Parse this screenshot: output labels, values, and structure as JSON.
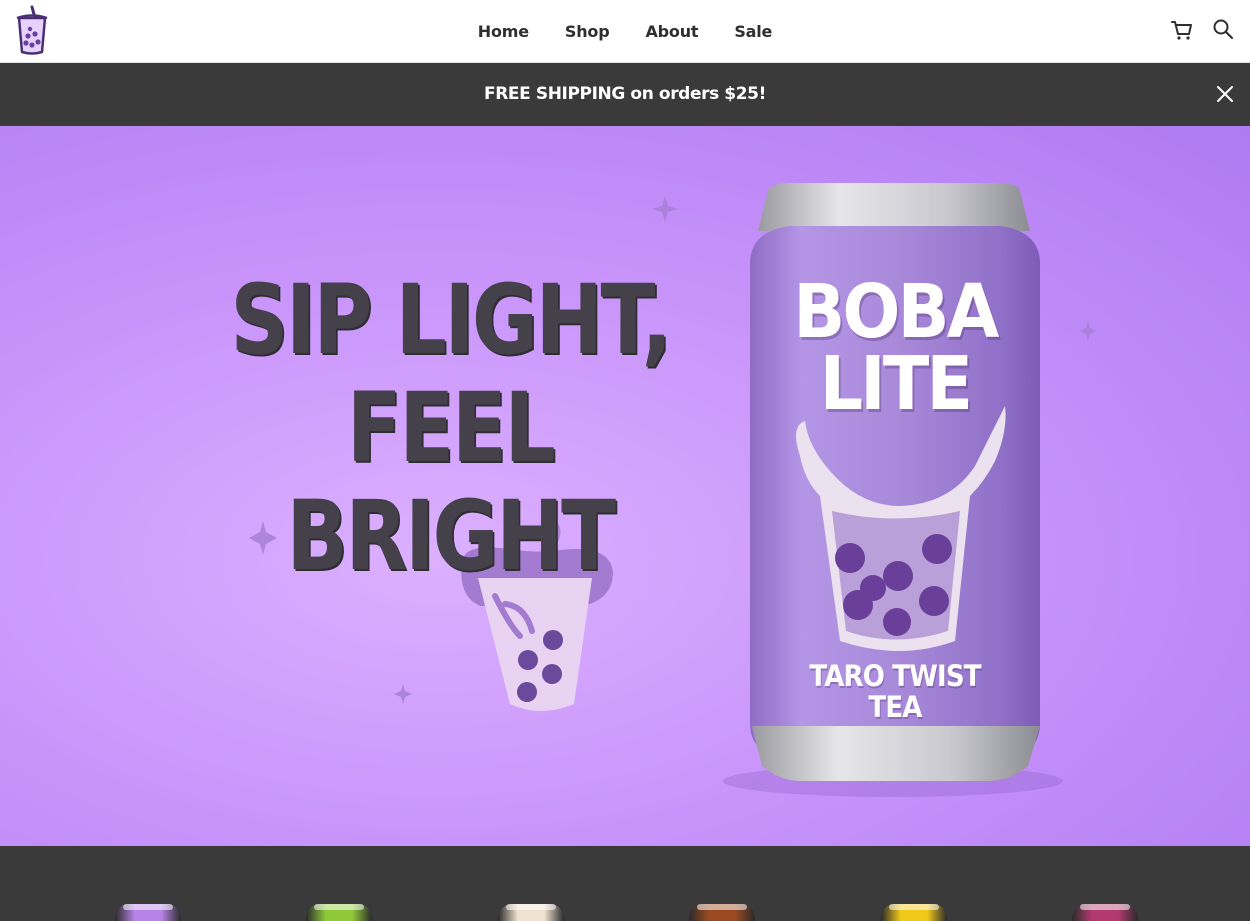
{
  "header": {
    "nav": [
      "Home",
      "Shop",
      "About",
      "Sale"
    ]
  },
  "icons": {
    "logo": "boba-cup-logo",
    "cart": "cart-icon",
    "search": "search-icon",
    "close": "close-icon"
  },
  "announcement": {
    "text": "FREE SHIPPING on orders $25!"
  },
  "hero": {
    "headline_line1": "SIP LIGHT,",
    "headline_line2": "FEEL BRIGHT",
    "can": {
      "brand_line1": "BOBA",
      "brand_line2": "LITE",
      "flavor_line1": "TARO TWIST",
      "flavor_line2": "TEA"
    }
  },
  "colors": {
    "hero_bg": "#c995fb",
    "headline": "#45414a",
    "can": "#a682d6",
    "dark_bar": "#3a3a3a"
  },
  "product_strip": {
    "can_colors": [
      "#b783e8",
      "#8fc93a",
      "#efe2cf",
      "#9a4a1f",
      "#f2c81a",
      "#b23a6e"
    ]
  }
}
